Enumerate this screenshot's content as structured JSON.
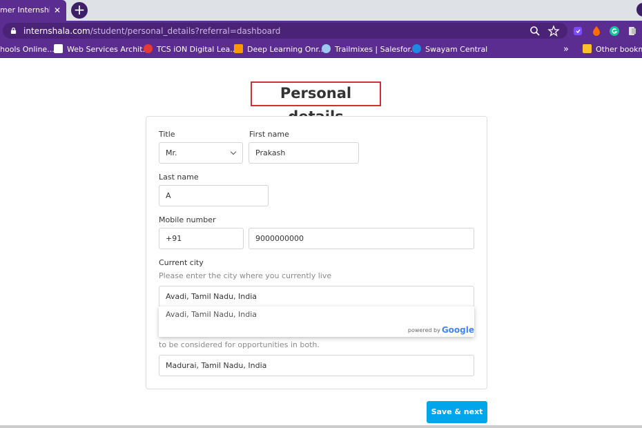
{
  "browser": {
    "tab_title": "mer Internship",
    "tab_close": "✕",
    "new_tab": "+",
    "url_domain": "internshala.com",
    "url_path": "/student/personal_details?referral=dashboard",
    "bookmarks": [
      {
        "label": "hools Online...",
        "color": "#6a1b9a"
      },
      {
        "label": "Web Services Archit...",
        "color": "#ffffff"
      },
      {
        "label": "TCS iON Digital Lea...",
        "color": "#e53935"
      },
      {
        "label": "Deep Learning Onr...",
        "color": "#ff9800"
      },
      {
        "label": "Trailmixes | Salesfor...",
        "color": "#9ec8f0"
      },
      {
        "label": "Swayam Central",
        "color": "#1e88e5"
      }
    ],
    "bookmarks_overflow": "»",
    "other_bookmarks": "Other bookma"
  },
  "page": {
    "heading": "Personal details",
    "title_label": "Title",
    "title_value": "Mr.",
    "first_name_label": "First name",
    "first_name_value": "Prakash",
    "last_name_label": "Last name",
    "last_name_value": "A",
    "mobile_label": "Mobile number",
    "mobile_code": "+91",
    "mobile_value": "9000000000",
    "city_label": "Current city",
    "city_hint": "Please enter the city where you currently live",
    "city_value": "Avadi, Tamil Nadu, India",
    "suggestion": "Avadi, Tamil Nadu, India",
    "powered_by": "powered by",
    "google": "Google",
    "second_city_hint": "to be considered for opportunities in both.",
    "second_city_value": "Madurai, Tamil Nadu, India",
    "save_button": "Save & next"
  },
  "colors": {
    "brand_purple": "#5c2d91",
    "highlight_red": "#d32f2f",
    "button_blue": "#00a5ec"
  }
}
